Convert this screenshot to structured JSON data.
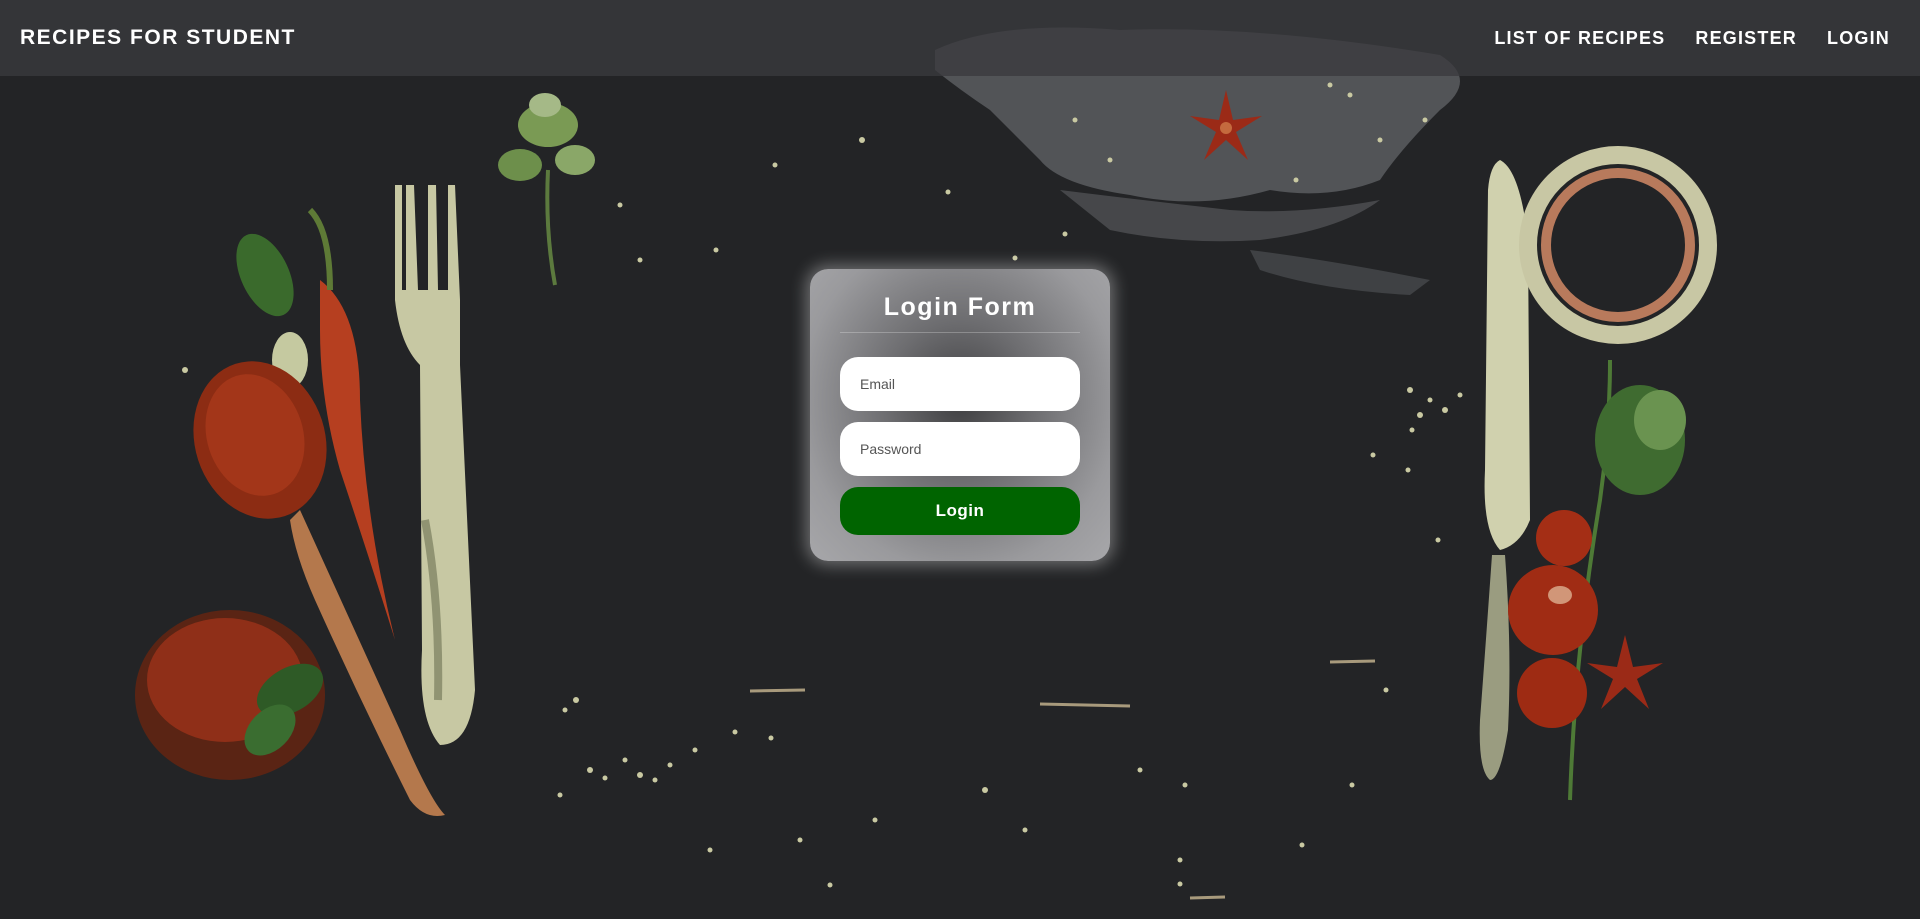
{
  "navbar": {
    "brand": "RECIPES FOR STUDENT",
    "links": [
      {
        "label": "LIST OF RECIPES"
      },
      {
        "label": "REGISTER"
      },
      {
        "label": "LOGIN"
      }
    ]
  },
  "login_form": {
    "title": "Login Form",
    "email_placeholder": "Email",
    "password_placeholder": "Password",
    "submit_label": "Login"
  },
  "colors": {
    "background": "#232426",
    "navbar": "#3a3a3e",
    "submit_button": "#006400",
    "text": "#ffffff"
  },
  "decorations": [
    "fork-illustration",
    "spoon-illustration",
    "chili-pepper-illustration",
    "herb-illustration",
    "star-anise-illustration",
    "knife-illustration",
    "tomato-illustration",
    "onion-ring-illustration"
  ]
}
